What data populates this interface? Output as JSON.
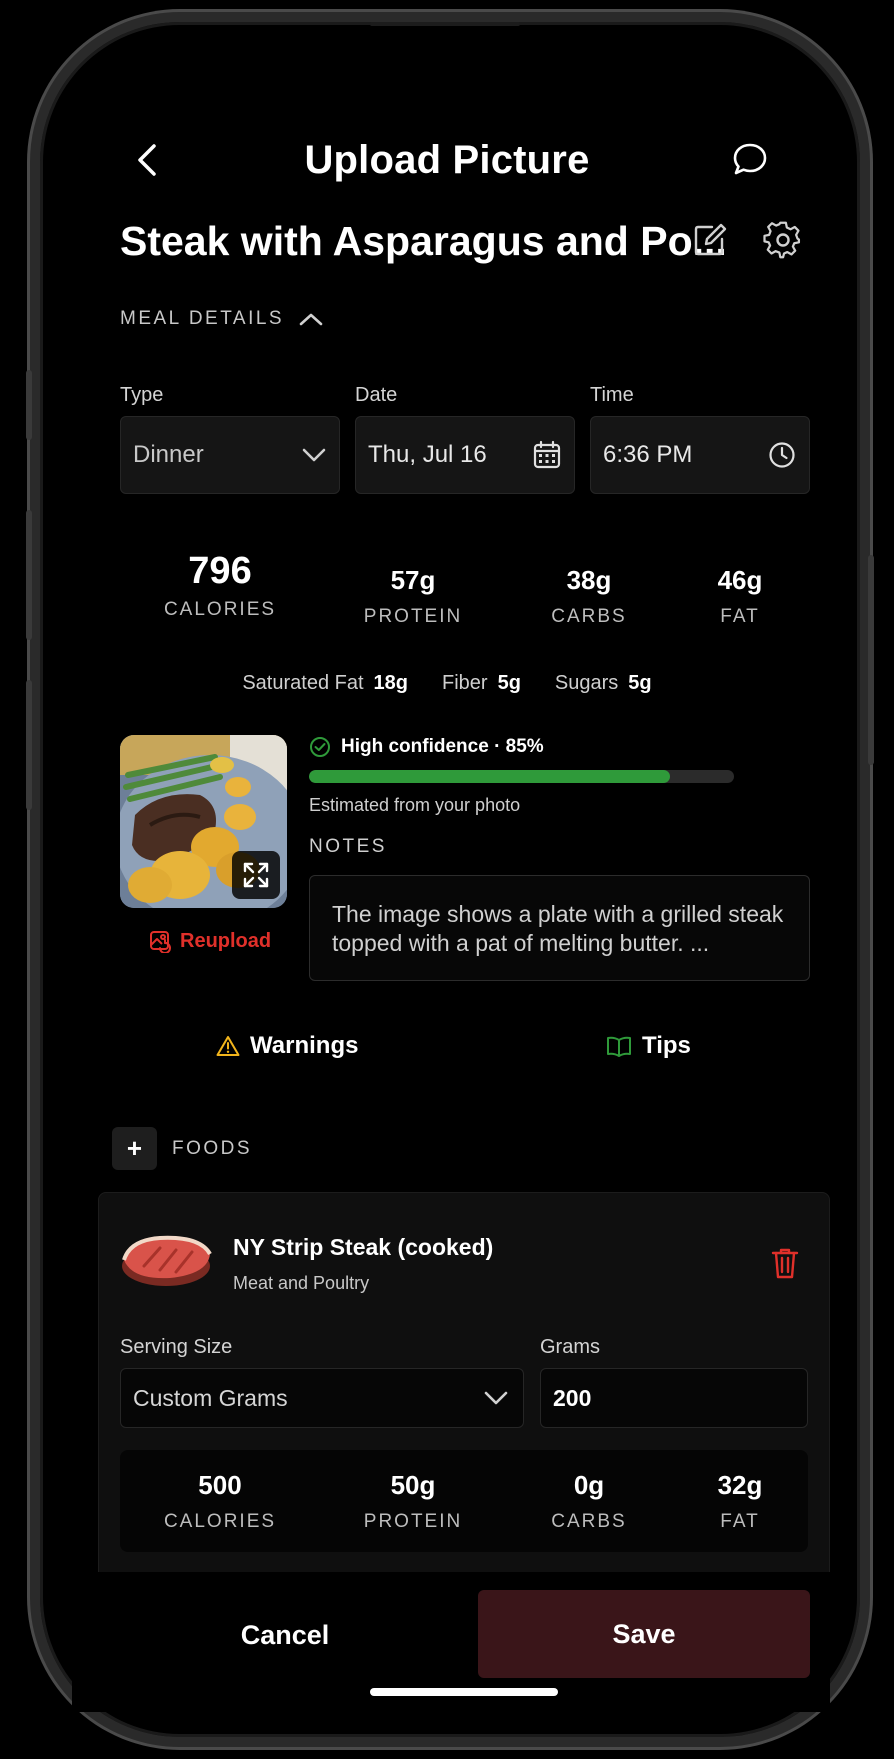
{
  "header": {
    "title": "Upload Picture",
    "back_icon": "chevron-left-icon",
    "chat_icon": "chat-bubble-icon"
  },
  "meal": {
    "name": "Steak with Asparagus and Po...",
    "edit_icon": "edit-icon",
    "settings_icon": "gear-icon"
  },
  "meal_details": {
    "section_label": "MEAL DETAILS",
    "type_label": "Type",
    "type_value": "Dinner",
    "date_label": "Date",
    "date_value": "Thu, Jul 16",
    "time_label": "Time",
    "time_value": "6:36 PM"
  },
  "totals": {
    "calories": {
      "value": "796",
      "label": "CALORIES"
    },
    "protein": {
      "value": "57g",
      "label": "PROTEIN"
    },
    "carbs": {
      "value": "38g",
      "label": "CARBS"
    },
    "fat": {
      "value": "46g",
      "label": "FAT"
    }
  },
  "micros": {
    "saturated_fat": {
      "label": "Saturated Fat",
      "value": "18g"
    },
    "fiber": {
      "label": "Fiber",
      "value": "5g"
    },
    "sugars": {
      "label": "Sugars",
      "value": "5g"
    }
  },
  "analysis": {
    "confidence_text": "High confidence · 85%",
    "confidence_fraction": 0.85,
    "estimated_text": "Estimated from your photo",
    "notes_label": "NOTES",
    "notes_text": "The image shows a plate with a grilled steak topped with a pat of melting butter. ...",
    "reupload_label": "Reupload"
  },
  "tabs": {
    "warnings": "Warnings",
    "tips": "Tips"
  },
  "foods": {
    "section_label": "FOODS",
    "add_label": "+",
    "items": [
      {
        "name": "NY Strip Steak (cooked)",
        "category": "Meat and Poultry",
        "serving_size_label": "Serving Size",
        "serving_size_value": "Custom Grams",
        "grams_label": "Grams",
        "grams_value": "200",
        "calories": {
          "value": "500",
          "label": "CALORIES"
        },
        "protein": {
          "value": "50g",
          "label": "PROTEIN"
        },
        "carbs": {
          "value": "0g",
          "label": "CARBS"
        },
        "fat": {
          "value": "32g",
          "label": "FAT"
        }
      }
    ]
  },
  "footer": {
    "cancel_label": "Cancel",
    "save_label": "Save"
  },
  "colors": {
    "accent_red": "#e0302a",
    "success_green": "#2f9a3a",
    "warning_yellow": "#f2b51c",
    "save_bg": "#3a1519"
  }
}
